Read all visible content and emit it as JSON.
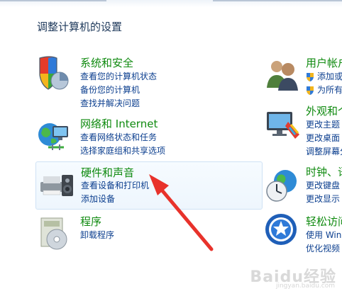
{
  "page": {
    "title": "调整计算机的设置"
  },
  "left_categories": [
    {
      "title": "系统和安全",
      "links": [
        "查看您的计算机状态",
        "备份您的计算机",
        "查找并解决问题"
      ]
    },
    {
      "title": "网络和 Internet",
      "links": [
        "查看网络状态和任务",
        "选择家庭组和共享选项"
      ]
    },
    {
      "title": "硬件和声音",
      "links": [
        "查看设备和打印机",
        "添加设备"
      ]
    },
    {
      "title": "程序",
      "links": [
        "卸载程序"
      ]
    }
  ],
  "right_categories": [
    {
      "title": "用户帐户",
      "links": [
        "添加或",
        "为所有"
      ]
    },
    {
      "title": "外观和个",
      "links": [
        "更改主题",
        "更改桌面",
        "调整屏幕分"
      ]
    },
    {
      "title": "时钟、语",
      "links": [
        "更改键盘",
        "更改显示"
      ]
    },
    {
      "title": "轻松访问",
      "links": [
        "使用 Win",
        "优化视频"
      ]
    }
  ],
  "watermark": {
    "text": "Baidu经验",
    "sub": "jingyan.baidu.com"
  },
  "colors": {
    "title_green": "#0f8a0f",
    "link_blue": "#0c3f8f",
    "arrow_red": "#e8322b"
  }
}
